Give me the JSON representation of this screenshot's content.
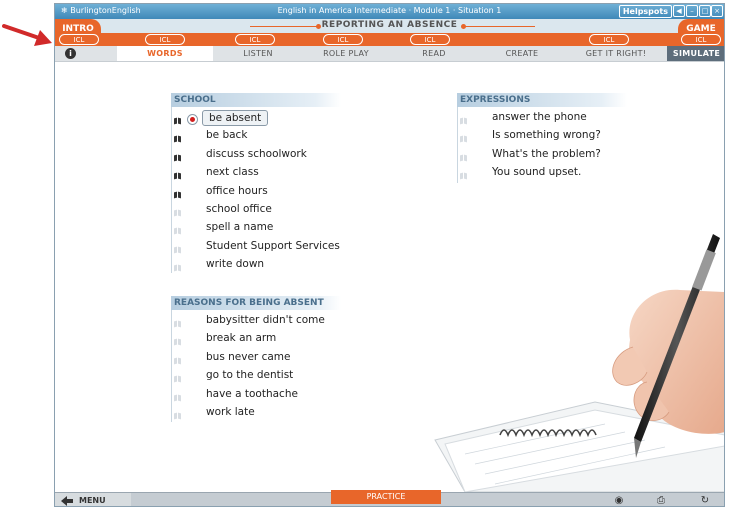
{
  "app": {
    "brand": "BurlingtonEnglish",
    "window_title": "English in America  Intermediate · Module 1 · Situation 1",
    "helpspots_label": "Helpspots"
  },
  "header": {
    "intro_label": "INTRO",
    "game_label": "GAME",
    "section_title": "REPORTING AN ABSENCE",
    "icl_labels": [
      "ICL",
      "ICL",
      "ICL",
      "ICL",
      "ICL",
      "ICL",
      "ICL"
    ]
  },
  "tabs": [
    {
      "label": "WORDS",
      "active": true
    },
    {
      "label": "LISTEN",
      "active": false
    },
    {
      "label": "ROLE PLAY",
      "active": false
    },
    {
      "label": "READ",
      "active": false
    },
    {
      "label": "CREATE",
      "active": false
    },
    {
      "label": "GET IT RIGHT!",
      "active": false
    },
    {
      "label": "SIMULATE",
      "active": false
    }
  ],
  "info_label": "i",
  "lists": {
    "school": {
      "title": "SCHOOL",
      "items": [
        {
          "text": "be absent",
          "state": "selected"
        },
        {
          "text": "be back",
          "state": "done"
        },
        {
          "text": "discuss schoolwork",
          "state": "done"
        },
        {
          "text": "next class",
          "state": "done"
        },
        {
          "text": "office hours",
          "state": "done"
        },
        {
          "text": "school office",
          "state": "new"
        },
        {
          "text": "spell a name",
          "state": "new"
        },
        {
          "text": "Student Support Services",
          "state": "new"
        },
        {
          "text": "write down",
          "state": "new"
        }
      ]
    },
    "reasons": {
      "title": "REASONS FOR BEING ABSENT",
      "items": [
        {
          "text": "babysitter didn't come",
          "state": "new"
        },
        {
          "text": "break an arm",
          "state": "new"
        },
        {
          "text": "bus never came",
          "state": "new"
        },
        {
          "text": "go to the dentist",
          "state": "new"
        },
        {
          "text": "have a toothache",
          "state": "new"
        },
        {
          "text": "work late",
          "state": "new"
        }
      ]
    },
    "expressions": {
      "title": "EXPRESSIONS",
      "items": [
        {
          "text": "answer the phone",
          "state": "new"
        },
        {
          "text": "Is something wrong?",
          "state": "new"
        },
        {
          "text": "What's the problem?",
          "state": "new"
        },
        {
          "text": "You sound upset.",
          "state": "new"
        }
      ]
    }
  },
  "footer": {
    "menu_label": "MENU",
    "practice_label": "PRACTICE",
    "icons": [
      "globe-icon",
      "print-icon",
      "refresh-icon"
    ]
  },
  "colors": {
    "accent": "#e8662a",
    "list_heading": "#4a6f8c",
    "annotation_arrow": "#d12a2a"
  }
}
